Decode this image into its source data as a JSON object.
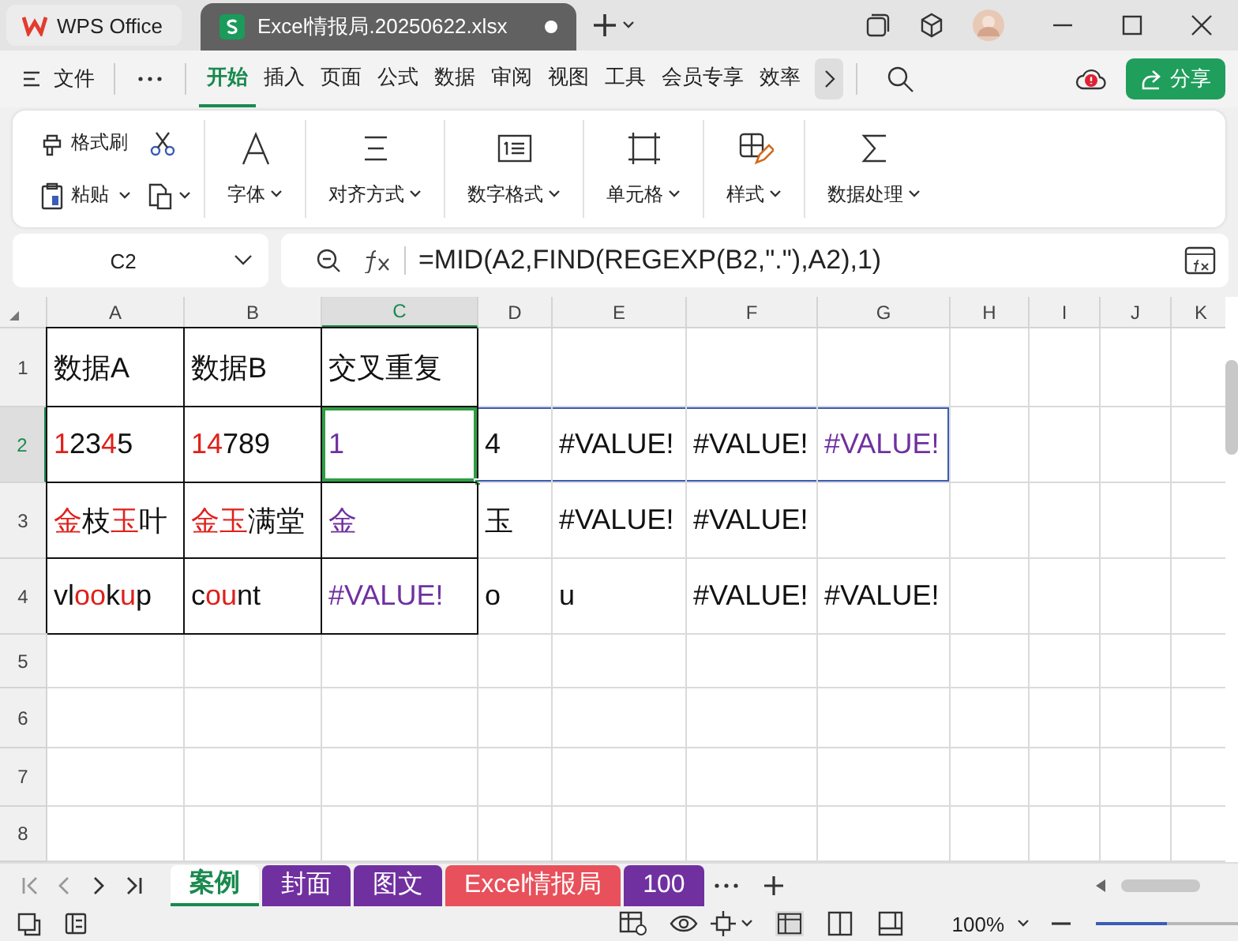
{
  "title_bar": {
    "app": "WPS Office",
    "tabs": [
      {
        "label": "Excel情报局.20250622.xlsx",
        "selected": true,
        "modified": true
      }
    ]
  },
  "menu": {
    "file": "文件",
    "items": [
      {
        "label": "开始",
        "selected": true
      },
      {
        "label": "插入",
        "selected": false
      },
      {
        "label": "页面",
        "selected": false
      },
      {
        "label": "公式",
        "selected": false
      },
      {
        "label": "数据",
        "selected": false
      },
      {
        "label": "审阅",
        "selected": false
      },
      {
        "label": "视图",
        "selected": false
      },
      {
        "label": "工具",
        "selected": false
      },
      {
        "label": "会员专享",
        "selected": false
      },
      {
        "label": "效率",
        "selected": false
      }
    ],
    "share": "分享"
  },
  "ribbon": {
    "format_painter": "格式刷",
    "paste": "粘贴",
    "groups": [
      {
        "label": "字体",
        "kind": "font"
      },
      {
        "label": "对齐方式",
        "kind": "align"
      },
      {
        "label": "数字格式",
        "kind": "number"
      },
      {
        "label": "单元格",
        "kind": "cell"
      },
      {
        "label": "样式",
        "kind": "style"
      },
      {
        "label": "数据处理",
        "kind": "sum"
      }
    ]
  },
  "formula_bar": {
    "name_box": "C2",
    "formula": "=MID(A2,FIND(REGEXP(B2,\".\"),A2),1)"
  },
  "sheet": {
    "columns": [
      {
        "label": "A",
        "selected": false
      },
      {
        "label": "B",
        "selected": false
      },
      {
        "label": "C",
        "selected": true
      },
      {
        "label": "D",
        "selected": false
      },
      {
        "label": "E",
        "selected": false
      },
      {
        "label": "F",
        "selected": false
      },
      {
        "label": "G",
        "selected": false
      },
      {
        "label": "H",
        "selected": false
      },
      {
        "label": "I",
        "selected": false
      },
      {
        "label": "J",
        "selected": false
      },
      {
        "label": "K",
        "selected": false
      }
    ],
    "rows": [
      {
        "header": "1",
        "selected": false,
        "cells": [
          {
            "runs": [
              {
                "text": "数据A"
              }
            ],
            "bordered": true,
            "active": false,
            "in_range": false
          },
          {
            "runs": [
              {
                "text": "数据B"
              }
            ],
            "bordered": true,
            "active": false,
            "in_range": false
          },
          {
            "runs": [
              {
                "text": "交叉重复"
              }
            ],
            "bordered": true,
            "active": false,
            "in_range": false
          }
        ]
      },
      {
        "header": "2",
        "selected": true,
        "cells": [
          {
            "runs": [
              {
                "text": "1",
                "color": "#e0201a"
              },
              {
                "text": "23"
              },
              {
                "text": "4",
                "color": "#e0201a"
              },
              {
                "text": "5"
              }
            ],
            "bordered": true,
            "active": false,
            "in_range": false
          },
          {
            "runs": [
              {
                "text": "14",
                "color": "#e0201a"
              },
              {
                "text": "789"
              }
            ],
            "bordered": true,
            "active": false,
            "in_range": false
          },
          {
            "runs": [
              {
                "text": "1"
              }
            ],
            "color": "#7030a0",
            "bordered": true,
            "active": true,
            "in_range": true
          },
          {
            "runs": [
              {
                "text": "4"
              }
            ],
            "bordered": false,
            "active": false,
            "in_range": true
          },
          {
            "runs": [
              {
                "text": "#VALUE!"
              }
            ],
            "bordered": false,
            "active": false,
            "in_range": true
          },
          {
            "runs": [
              {
                "text": "#VALUE!"
              }
            ],
            "bordered": false,
            "active": false,
            "in_range": true
          },
          {
            "runs": [
              {
                "text": "#VALUE!"
              }
            ],
            "color": "#7030a0",
            "bordered": false,
            "active": false,
            "in_range": true
          }
        ]
      },
      {
        "header": "3",
        "selected": false,
        "cells": [
          {
            "runs": [
              {
                "text": "金",
                "color": "#e0201a"
              },
              {
                "text": "枝"
              },
              {
                "text": "玉",
                "color": "#e0201a"
              },
              {
                "text": "叶"
              }
            ],
            "bordered": true,
            "active": false,
            "in_range": false
          },
          {
            "runs": [
              {
                "text": "金玉",
                "color": "#e0201a"
              },
              {
                "text": "满堂"
              }
            ],
            "bordered": true,
            "active": false,
            "in_range": false
          },
          {
            "runs": [
              {
                "text": "金"
              }
            ],
            "color": "#7030a0",
            "bordered": true,
            "active": false,
            "in_range": false
          },
          {
            "runs": [
              {
                "text": "玉"
              }
            ],
            "bordered": false,
            "active": false,
            "in_range": false
          },
          {
            "runs": [
              {
                "text": "#VALUE!"
              }
            ],
            "bordered": false,
            "active": false,
            "in_range": false
          },
          {
            "runs": [
              {
                "text": "#VALUE!"
              }
            ],
            "bordered": false,
            "active": false,
            "in_range": false
          }
        ]
      },
      {
        "header": "4",
        "selected": false,
        "cells": [
          {
            "runs": [
              {
                "text": "vl"
              },
              {
                "text": "oo",
                "color": "#e0201a"
              },
              {
                "text": "k"
              },
              {
                "text": "u",
                "color": "#e0201a"
              },
              {
                "text": "p"
              }
            ],
            "bordered": true,
            "active": false,
            "in_range": false
          },
          {
            "runs": [
              {
                "text": "c"
              },
              {
                "text": "ou",
                "color": "#e0201a"
              },
              {
                "text": "nt"
              }
            ],
            "bordered": true,
            "active": false,
            "in_range": false
          },
          {
            "runs": [
              {
                "text": "#VALUE!"
              }
            ],
            "color": "#7030a0",
            "bordered": true,
            "active": false,
            "in_range": false
          },
          {
            "runs": [
              {
                "text": "o"
              }
            ],
            "bordered": false,
            "active": false,
            "in_range": false
          },
          {
            "runs": [
              {
                "text": "u"
              }
            ],
            "bordered": false,
            "active": false,
            "in_range": false
          },
          {
            "runs": [
              {
                "text": "#VALUE!"
              }
            ],
            "bordered": false,
            "active": false,
            "in_range": false
          },
          {
            "runs": [
              {
                "text": "#VALUE!"
              }
            ],
            "bordered": false,
            "active": false,
            "in_range": false
          }
        ]
      },
      {
        "header": "5",
        "selected": false
      },
      {
        "header": "6",
        "selected": false
      },
      {
        "header": "7",
        "selected": false
      },
      {
        "header": "8",
        "selected": false
      }
    ]
  },
  "sheet_tabs": [
    {
      "label": "案例",
      "selected": true,
      "color": "#ffffff"
    },
    {
      "label": "封面",
      "selected": false,
      "color": "#7030a0"
    },
    {
      "label": "图文",
      "selected": false,
      "color": "#7030a0"
    },
    {
      "label": "Excel情报局",
      "selected": false,
      "color": "#e8505b"
    },
    {
      "label": "100",
      "selected": false,
      "color": "#7030a0"
    }
  ],
  "status_bar": {
    "zoom": "100%",
    "zoom_slider": {
      "level": 0.5
    }
  }
}
